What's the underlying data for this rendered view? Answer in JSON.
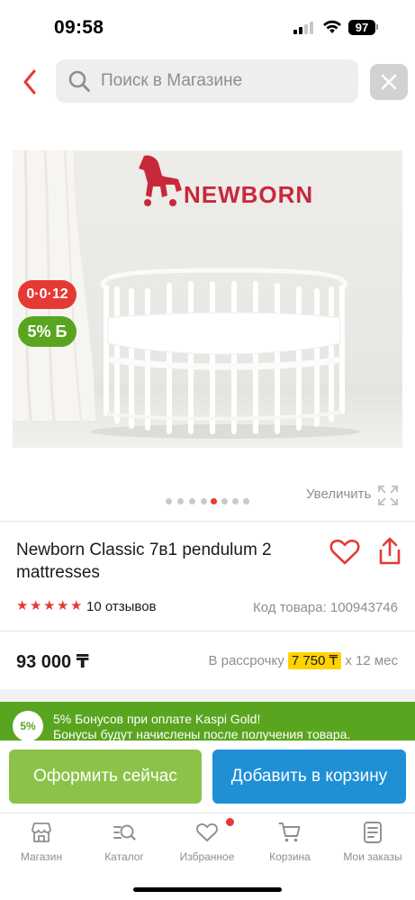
{
  "status_bar": {
    "time": "09:58",
    "battery": "97"
  },
  "search": {
    "placeholder": "Поиск в Магазине"
  },
  "product": {
    "brand_sign": "NEWBORN",
    "badge_installment": "0·0·12",
    "badge_bonus": "5% Б",
    "zoom_label": "Увеличить",
    "gallery": {
      "total": 8,
      "active_index": 4
    },
    "title": "Newborn Classic 7в1 pendulum 2 mattresses",
    "rating": 5,
    "reviews": "10 отзывов",
    "sku": "Код товара: 100943746",
    "price": "93 000 ₸",
    "installment_prefix": "В рассрочку",
    "installment_amount": "7 750 ₸",
    "installment_suffix": "х 12 мес"
  },
  "bonus_banner": {
    "badge": "5%",
    "line1": "5% Бонусов при оплате Kaspi Gold!",
    "line2": "Бонусы будут начислены после получения товара."
  },
  "actions": {
    "checkout_label": "Оформить сейчас",
    "cart_label": "Добавить в корзину"
  },
  "tabs": [
    {
      "label": "Магазин",
      "icon": "store-icon"
    },
    {
      "label": "Каталог",
      "icon": "catalog-search-icon"
    },
    {
      "label": "Избранное",
      "icon": "heart-icon",
      "badge": true
    },
    {
      "label": "Корзина",
      "icon": "cart-icon"
    },
    {
      "label": "Мои заказы",
      "icon": "orders-icon"
    }
  ],
  "colors": {
    "accent_red": "#e53935",
    "bonus_green": "#5aa520",
    "checkout_green": "#8bc34a",
    "cart_blue": "#1f8fd6",
    "installment_highlight": "#ffd200"
  }
}
